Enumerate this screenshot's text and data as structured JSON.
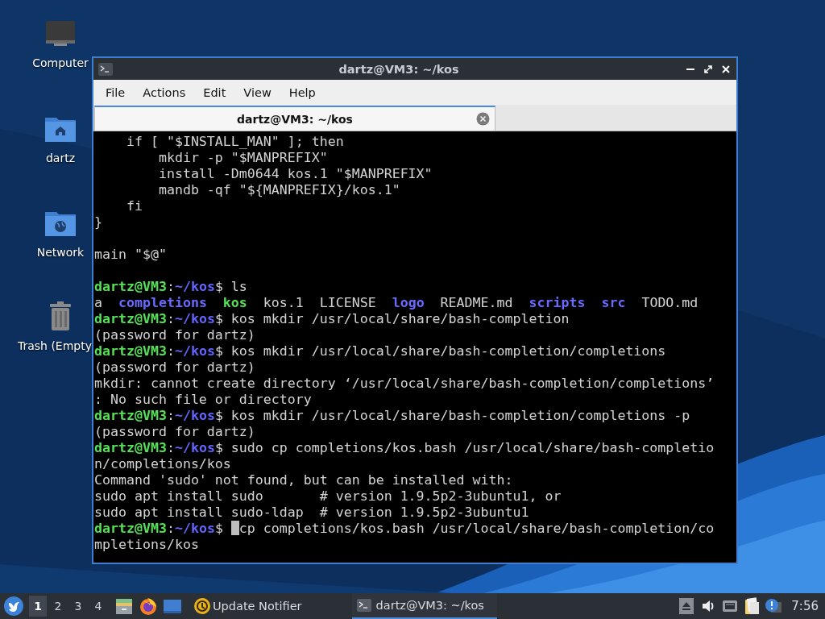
{
  "desktop_icons": [
    {
      "label": "Computer",
      "kind": "computer"
    },
    {
      "label": "dartz",
      "kind": "home"
    },
    {
      "label": "Network",
      "kind": "network"
    },
    {
      "label": "Trash (Empty",
      "kind": "trash"
    }
  ],
  "window": {
    "title": "dartz@VM3: ~/kos",
    "menu": [
      "File",
      "Actions",
      "Edit",
      "View",
      "Help"
    ],
    "tabs": [
      {
        "label": "dartz@VM3: ~/kos",
        "selected": true
      }
    ],
    "terminal": {
      "lines": [
        {
          "kind": "output",
          "segments": [
            {
              "kind": "text",
              "text": "    if [ \"$INSTALL_MAN\" ]; then"
            }
          ]
        },
        {
          "kind": "output",
          "segments": [
            {
              "kind": "text",
              "text": "        mkdir -p \"$MANPREFIX\""
            }
          ]
        },
        {
          "kind": "output",
          "segments": [
            {
              "kind": "text",
              "text": "        install -Dm0644 kos.1 \"$MANPREFIX\""
            }
          ]
        },
        {
          "kind": "output",
          "segments": [
            {
              "kind": "text",
              "text": "        mandb -qf \"${MANPREFIX}/kos.1\""
            }
          ]
        },
        {
          "kind": "output",
          "segments": [
            {
              "kind": "text",
              "text": "    fi"
            }
          ]
        },
        {
          "kind": "output",
          "segments": [
            {
              "kind": "text",
              "text": "}"
            }
          ]
        },
        {
          "kind": "blank"
        },
        {
          "kind": "output",
          "segments": [
            {
              "kind": "text",
              "text": "main \"$@\""
            }
          ]
        },
        {
          "kind": "blank"
        },
        {
          "kind": "output",
          "segments": [
            {
              "kind": "user",
              "text": "dartz@VM3"
            },
            {
              "kind": "text",
              "text": ":"
            },
            {
              "kind": "path",
              "text": "~/kos"
            },
            {
              "kind": "text",
              "text": "$ ls"
            }
          ]
        },
        {
          "kind": "output",
          "segments": [
            {
              "kind": "text",
              "text": "a  "
            },
            {
              "kind": "dir",
              "text": "completions  "
            },
            {
              "kind": "exe",
              "text": "kos"
            },
            {
              "kind": "text",
              "text": "  kos.1  LICENSE  "
            },
            {
              "kind": "dir",
              "text": "logo"
            },
            {
              "kind": "text",
              "text": "  README.md  "
            },
            {
              "kind": "dir",
              "text": "scripts  "
            },
            {
              "kind": "dir",
              "text": "src"
            },
            {
              "kind": "text",
              "text": "  TODO.md"
            }
          ]
        },
        {
          "kind": "output",
          "segments": [
            {
              "kind": "user",
              "text": "dartz@VM3"
            },
            {
              "kind": "text",
              "text": ":"
            },
            {
              "kind": "path",
              "text": "~/kos"
            },
            {
              "kind": "text",
              "text": "$ kos mkdir /usr/local/share/bash-completion"
            }
          ]
        },
        {
          "kind": "output",
          "segments": [
            {
              "kind": "text",
              "text": "(password for dartz)"
            }
          ]
        },
        {
          "kind": "output",
          "segments": [
            {
              "kind": "user",
              "text": "dartz@VM3"
            },
            {
              "kind": "text",
              "text": ":"
            },
            {
              "kind": "path",
              "text": "~/kos"
            },
            {
              "kind": "text",
              "text": "$ kos mkdir /usr/local/share/bash-completion/completions"
            }
          ]
        },
        {
          "kind": "output",
          "segments": [
            {
              "kind": "text",
              "text": "(password for dartz)"
            }
          ]
        },
        {
          "kind": "output",
          "segments": [
            {
              "kind": "text",
              "text": "mkdir: cannot create directory ‘/usr/local/share/bash-completion/completions’"
            }
          ]
        },
        {
          "kind": "output",
          "segments": [
            {
              "kind": "text",
              "text": ": No such file or directory"
            }
          ]
        },
        {
          "kind": "output",
          "segments": [
            {
              "kind": "user",
              "text": "dartz@VM3"
            },
            {
              "kind": "text",
              "text": ":"
            },
            {
              "kind": "path",
              "text": "~/kos"
            },
            {
              "kind": "text",
              "text": "$ kos mkdir /usr/local/share/bash-completion/completions -p"
            }
          ]
        },
        {
          "kind": "output",
          "segments": [
            {
              "kind": "text",
              "text": "(password for dartz)"
            }
          ]
        },
        {
          "kind": "output",
          "segments": [
            {
              "kind": "user",
              "text": "dartz@VM3"
            },
            {
              "kind": "text",
              "text": ":"
            },
            {
              "kind": "path",
              "text": "~/kos"
            },
            {
              "kind": "text",
              "text": "$ sudo cp completions/kos.bash /usr/local/share/bash-completio"
            }
          ]
        },
        {
          "kind": "output",
          "segments": [
            {
              "kind": "text",
              "text": "n/completions/kos"
            }
          ]
        },
        {
          "kind": "output",
          "segments": [
            {
              "kind": "text",
              "text": "Command 'sudo' not found, but can be installed with:"
            }
          ]
        },
        {
          "kind": "output",
          "segments": [
            {
              "kind": "text",
              "text": "sudo apt install sudo       # version 1.9.5p2-3ubuntu1, or"
            }
          ]
        },
        {
          "kind": "output",
          "segments": [
            {
              "kind": "text",
              "text": "sudo apt install sudo-ldap  # version 1.9.5p2-3ubuntu1"
            }
          ]
        },
        {
          "kind": "output",
          "segments": [
            {
              "kind": "user",
              "text": "dartz@VM3"
            },
            {
              "kind": "text",
              "text": ":"
            },
            {
              "kind": "path",
              "text": "~/kos"
            },
            {
              "kind": "text",
              "text": "$ "
            },
            {
              "kind": "cursor"
            },
            {
              "kind": "text",
              "text": "cp completions/kos.bash /usr/local/share/bash-completion/co"
            }
          ]
        },
        {
          "kind": "output",
          "segments": [
            {
              "kind": "text",
              "text": "mpletions/kos"
            }
          ]
        }
      ]
    }
  },
  "taskbar": {
    "workspaces": [
      {
        "label": "1",
        "selected": true
      },
      {
        "label": "2",
        "selected": false
      },
      {
        "label": "3",
        "selected": false
      },
      {
        "label": "4",
        "selected": false
      }
    ],
    "launchers": [
      {
        "kind": "files"
      },
      {
        "kind": "browser"
      },
      {
        "kind": "desktop"
      }
    ],
    "notifier": {
      "label": "Update Notifier"
    },
    "tasks": [
      {
        "label": "dartz@VM3: ~/kos",
        "selected": true
      }
    ],
    "tray": [
      {
        "kind": "eject"
      },
      {
        "kind": "volume"
      },
      {
        "kind": "network"
      },
      {
        "kind": "clipboard"
      },
      {
        "kind": "notification"
      }
    ],
    "clock": "7:56"
  }
}
